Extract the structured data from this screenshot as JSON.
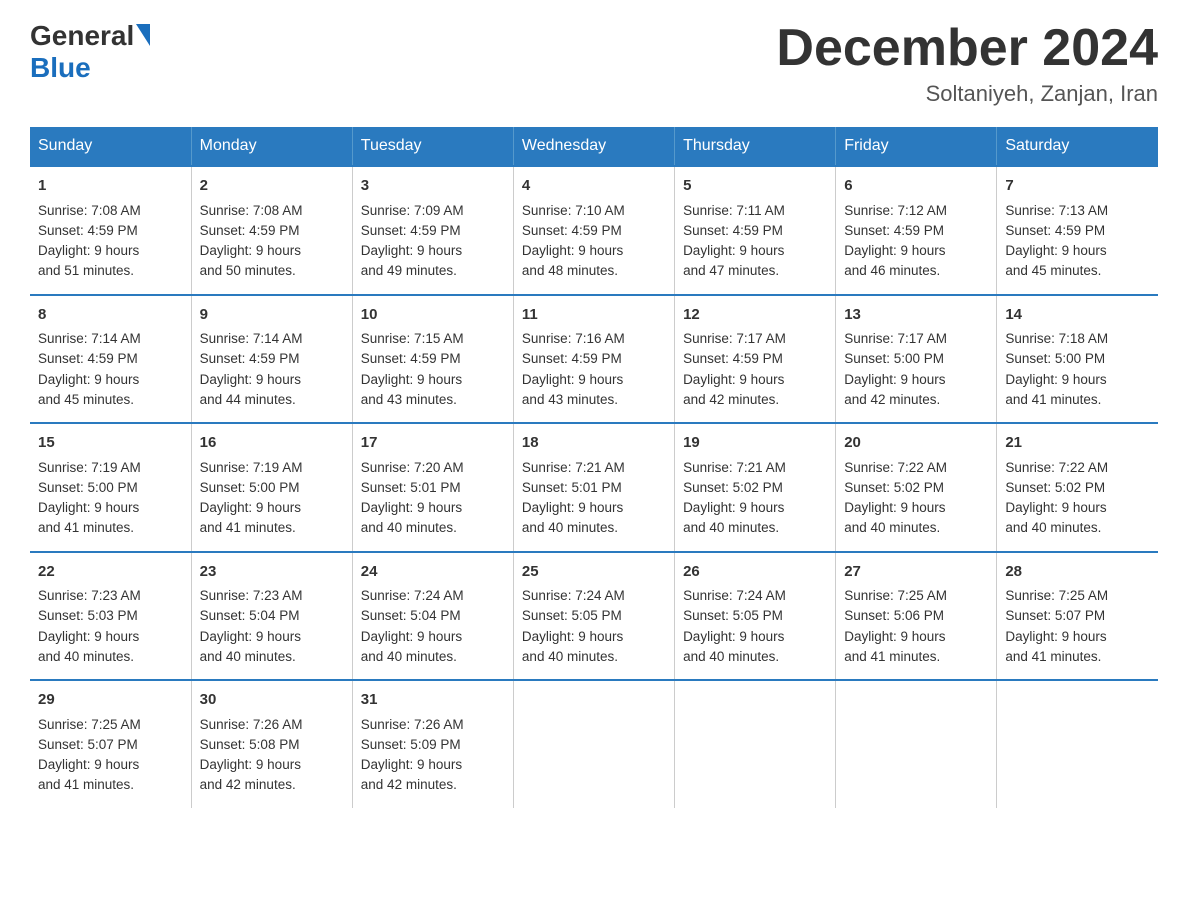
{
  "logo": {
    "general": "General",
    "blue": "Blue"
  },
  "header": {
    "month": "December 2024",
    "location": "Soltaniyeh, Zanjan, Iran"
  },
  "weekdays": [
    "Sunday",
    "Monday",
    "Tuesday",
    "Wednesday",
    "Thursday",
    "Friday",
    "Saturday"
  ],
  "weeks": [
    [
      {
        "day": "1",
        "sunrise": "7:08 AM",
        "sunset": "4:59 PM",
        "daylight": "9 hours and 51 minutes."
      },
      {
        "day": "2",
        "sunrise": "7:08 AM",
        "sunset": "4:59 PM",
        "daylight": "9 hours and 50 minutes."
      },
      {
        "day": "3",
        "sunrise": "7:09 AM",
        "sunset": "4:59 PM",
        "daylight": "9 hours and 49 minutes."
      },
      {
        "day": "4",
        "sunrise": "7:10 AM",
        "sunset": "4:59 PM",
        "daylight": "9 hours and 48 minutes."
      },
      {
        "day": "5",
        "sunrise": "7:11 AM",
        "sunset": "4:59 PM",
        "daylight": "9 hours and 47 minutes."
      },
      {
        "day": "6",
        "sunrise": "7:12 AM",
        "sunset": "4:59 PM",
        "daylight": "9 hours and 46 minutes."
      },
      {
        "day": "7",
        "sunrise": "7:13 AM",
        "sunset": "4:59 PM",
        "daylight": "9 hours and 45 minutes."
      }
    ],
    [
      {
        "day": "8",
        "sunrise": "7:14 AM",
        "sunset": "4:59 PM",
        "daylight": "9 hours and 45 minutes."
      },
      {
        "day": "9",
        "sunrise": "7:14 AM",
        "sunset": "4:59 PM",
        "daylight": "9 hours and 44 minutes."
      },
      {
        "day": "10",
        "sunrise": "7:15 AM",
        "sunset": "4:59 PM",
        "daylight": "9 hours and 43 minutes."
      },
      {
        "day": "11",
        "sunrise": "7:16 AM",
        "sunset": "4:59 PM",
        "daylight": "9 hours and 43 minutes."
      },
      {
        "day": "12",
        "sunrise": "7:17 AM",
        "sunset": "4:59 PM",
        "daylight": "9 hours and 42 minutes."
      },
      {
        "day": "13",
        "sunrise": "7:17 AM",
        "sunset": "5:00 PM",
        "daylight": "9 hours and 42 minutes."
      },
      {
        "day": "14",
        "sunrise": "7:18 AM",
        "sunset": "5:00 PM",
        "daylight": "9 hours and 41 minutes."
      }
    ],
    [
      {
        "day": "15",
        "sunrise": "7:19 AM",
        "sunset": "5:00 PM",
        "daylight": "9 hours and 41 minutes."
      },
      {
        "day": "16",
        "sunrise": "7:19 AM",
        "sunset": "5:00 PM",
        "daylight": "9 hours and 41 minutes."
      },
      {
        "day": "17",
        "sunrise": "7:20 AM",
        "sunset": "5:01 PM",
        "daylight": "9 hours and 40 minutes."
      },
      {
        "day": "18",
        "sunrise": "7:21 AM",
        "sunset": "5:01 PM",
        "daylight": "9 hours and 40 minutes."
      },
      {
        "day": "19",
        "sunrise": "7:21 AM",
        "sunset": "5:02 PM",
        "daylight": "9 hours and 40 minutes."
      },
      {
        "day": "20",
        "sunrise": "7:22 AM",
        "sunset": "5:02 PM",
        "daylight": "9 hours and 40 minutes."
      },
      {
        "day": "21",
        "sunrise": "7:22 AM",
        "sunset": "5:02 PM",
        "daylight": "9 hours and 40 minutes."
      }
    ],
    [
      {
        "day": "22",
        "sunrise": "7:23 AM",
        "sunset": "5:03 PM",
        "daylight": "9 hours and 40 minutes."
      },
      {
        "day": "23",
        "sunrise": "7:23 AM",
        "sunset": "5:04 PM",
        "daylight": "9 hours and 40 minutes."
      },
      {
        "day": "24",
        "sunrise": "7:24 AM",
        "sunset": "5:04 PM",
        "daylight": "9 hours and 40 minutes."
      },
      {
        "day": "25",
        "sunrise": "7:24 AM",
        "sunset": "5:05 PM",
        "daylight": "9 hours and 40 minutes."
      },
      {
        "day": "26",
        "sunrise": "7:24 AM",
        "sunset": "5:05 PM",
        "daylight": "9 hours and 40 minutes."
      },
      {
        "day": "27",
        "sunrise": "7:25 AM",
        "sunset": "5:06 PM",
        "daylight": "9 hours and 41 minutes."
      },
      {
        "day": "28",
        "sunrise": "7:25 AM",
        "sunset": "5:07 PM",
        "daylight": "9 hours and 41 minutes."
      }
    ],
    [
      {
        "day": "29",
        "sunrise": "7:25 AM",
        "sunset": "5:07 PM",
        "daylight": "9 hours and 41 minutes."
      },
      {
        "day": "30",
        "sunrise": "7:26 AM",
        "sunset": "5:08 PM",
        "daylight": "9 hours and 42 minutes."
      },
      {
        "day": "31",
        "sunrise": "7:26 AM",
        "sunset": "5:09 PM",
        "daylight": "9 hours and 42 minutes."
      },
      null,
      null,
      null,
      null
    ]
  ]
}
